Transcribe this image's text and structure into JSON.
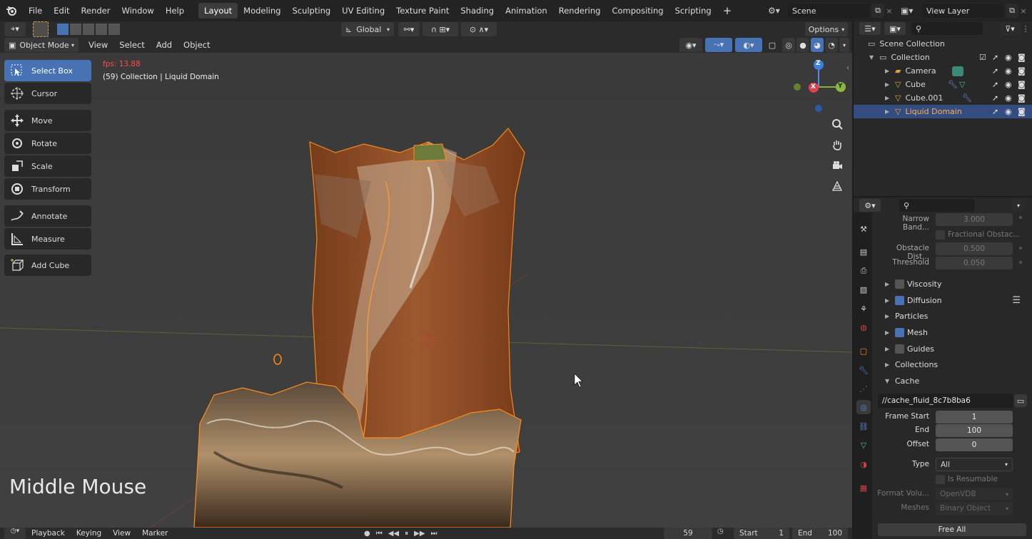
{
  "menubar": {
    "items": [
      "File",
      "Edit",
      "Render",
      "Window",
      "Help"
    ],
    "workspaces": [
      "Layout",
      "Modeling",
      "Sculpting",
      "UV Editing",
      "Texture Paint",
      "Shading",
      "Animation",
      "Rendering",
      "Compositing",
      "Scripting"
    ],
    "active_workspace": "Layout",
    "scene": "Scene",
    "view_layer": "View Layer"
  },
  "header": {
    "orientation": "Global",
    "options": "Options",
    "mode": "Object Mode",
    "menus": [
      "View",
      "Select",
      "Add",
      "Object"
    ]
  },
  "viewport": {
    "fps": "fps: 13.88",
    "info": "(59) Collection | Liquid Domain",
    "overlay_text": "Middle Mouse",
    "gizmo": {
      "x": "X",
      "y": "Y",
      "z": "Z"
    }
  },
  "toolbar": {
    "tools": [
      {
        "label": "Select Box",
        "icon": "select-box-icon",
        "active": true
      },
      {
        "label": "Cursor",
        "icon": "cursor-icon",
        "active": false
      },
      {
        "label": "Move",
        "icon": "move-icon",
        "active": false
      },
      {
        "label": "Rotate",
        "icon": "rotate-icon",
        "active": false
      },
      {
        "label": "Scale",
        "icon": "scale-icon",
        "active": false
      },
      {
        "label": "Transform",
        "icon": "transform-icon",
        "active": false
      },
      {
        "label": "Annotate",
        "icon": "annotate-icon",
        "active": false
      },
      {
        "label": "Measure",
        "icon": "measure-icon",
        "active": false
      },
      {
        "label": "Add Cube",
        "icon": "add-cube-icon",
        "active": false
      }
    ]
  },
  "outliner": {
    "root": "Scene Collection",
    "collection": "Collection",
    "items": [
      {
        "label": "Camera",
        "selected": false
      },
      {
        "label": "Cube",
        "selected": false
      },
      {
        "label": "Cube.001",
        "selected": false
      },
      {
        "label": "Liquid Domain",
        "selected": true
      }
    ]
  },
  "properties": {
    "rows_top": [
      {
        "label": "Narrow Band...",
        "value": "3.000",
        "dim": true
      },
      {
        "label": "",
        "value": "Fractional Obstac...",
        "checkbox": true
      },
      {
        "label": "Obstacle Dist...",
        "value": "0.500",
        "dim": true
      },
      {
        "label": "Threshold",
        "value": "0.050",
        "dim": true
      }
    ],
    "panels": [
      {
        "label": "Viscosity",
        "check": "off"
      },
      {
        "label": "Diffusion",
        "check": "on"
      },
      {
        "label": "Particles",
        "check": "none"
      },
      {
        "label": "Mesh",
        "check": "on"
      },
      {
        "label": "Guides",
        "check": "off"
      },
      {
        "label": "Collections",
        "check": "none"
      },
      {
        "label": "Cache",
        "check": "none",
        "open": true
      }
    ],
    "cache_path": "//cache_fluid_8c7b8ba6",
    "frame_start_label": "Frame Start",
    "frame_start": "1",
    "end_label": "End",
    "end": "100",
    "offset_label": "Offset",
    "offset": "0",
    "type_label": "Type",
    "type": "All",
    "resumable": "Is Resumable",
    "format_label": "Format Volu...",
    "format": "OpenVDB",
    "meshes_label": "Meshes",
    "meshes": "Binary Object",
    "free_all": "Free All"
  },
  "timeline": {
    "menus": [
      "Playback",
      "Keying",
      "View",
      "Marker"
    ],
    "current_frame": "59",
    "start_label": "Start",
    "start": "1",
    "end_label": "End",
    "end": "100"
  },
  "colors": {
    "accent": "#4772b3",
    "selection_orange": "#ff8c1a",
    "fps_red": "#ff4a4a"
  }
}
